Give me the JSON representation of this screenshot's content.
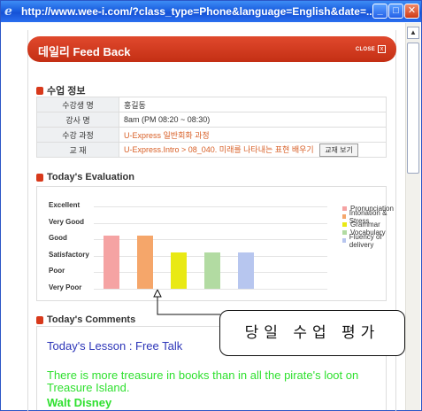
{
  "window": {
    "title": "http://www.wee-i.com/?class_type=Phone&language=English&date=..."
  },
  "header": {
    "title": "데일리 Feed Back",
    "close_label": "CLOSE",
    "close_glyph": "x"
  },
  "info_section": {
    "title": "수업 정보",
    "rows": [
      {
        "label": "수강생 명",
        "value": "홍길동"
      },
      {
        "label": "강사 명",
        "value": "8am (PM 08:20 ~ 08:30)"
      },
      {
        "label": "수강 과정",
        "value": "U-Express 일반회화 과정"
      },
      {
        "label": "교 재",
        "value": "U-Express.Intro > 08_040. 미래를 나타내는 표현 배우기"
      }
    ],
    "book_button": "교재 보기"
  },
  "evaluation_section": {
    "title": "Today's Evaluation"
  },
  "chart_data": {
    "type": "bar",
    "y_levels": [
      "Excellent",
      "Very Good",
      "Good",
      "Satisfactory",
      "Poor",
      "Very Poor"
    ],
    "categories": [
      "Pronunciation",
      "Intonation & Stress",
      "Grammar",
      "Vocabulary",
      "Fluency of delivery"
    ],
    "values": [
      "Good",
      "Good",
      "Satisfactory",
      "Satisfactory",
      "Satisfactory"
    ],
    "colors": [
      "#f5a3a3",
      "#f5a66a",
      "#e9e914",
      "#b2dba2",
      "#b7c6ef"
    ],
    "legend_position": "right"
  },
  "comments_section": {
    "title": "Today's Comments",
    "lesson": "Today's Lesson : Free Talk",
    "quote": "There is more treasure in books than in all the pirate's loot on Treasure Island.",
    "author": "Walt Disney"
  },
  "callout": {
    "text": "당일 수업 평가"
  }
}
